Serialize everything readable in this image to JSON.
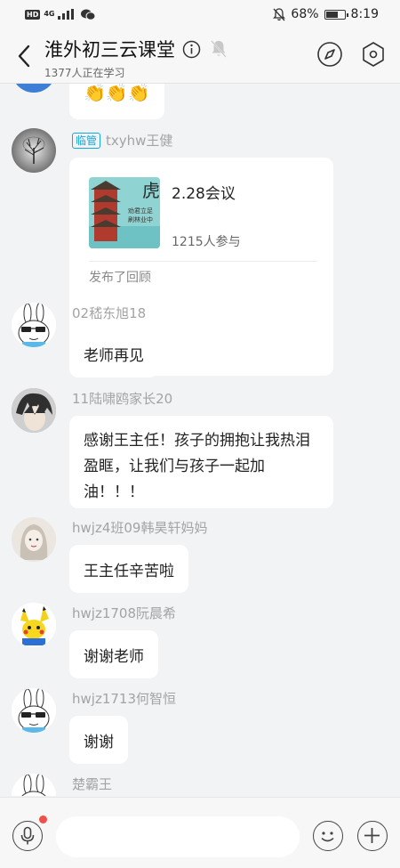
{
  "status_bar": {
    "left_badge": "HD",
    "network": "4G",
    "battery_pct": "68%",
    "battery_level": 0.68,
    "time": "8:19"
  },
  "header": {
    "title": "淮外初三云课堂",
    "subtitle": "1377人正在学习"
  },
  "messages": [
    {
      "type": "text",
      "sender": "",
      "text": "👏👏👏"
    },
    {
      "type": "card",
      "sender": "txyhw王健",
      "role_tag": "临管",
      "card_title": "2.28会议",
      "card_sub": "1215人参与",
      "card_footer": "发布了回顾",
      "thumb_text1": "劝君立足",
      "thumb_text2": "刷林业中"
    },
    {
      "type": "text",
      "sender": "02嵇东旭18",
      "text": "老师再见"
    },
    {
      "type": "text",
      "sender": "11陆啸鸥家长20",
      "text": "感谢王主任！孩子的拥抱让我热泪盈眶，让我们与孩子一起加油！！！"
    },
    {
      "type": "text",
      "sender": "hwjz4班09韩昊轩妈妈",
      "text": "王主任辛苦啦"
    },
    {
      "type": "text",
      "sender": "hwjz1708阮晨希",
      "text": "谢谢老师"
    },
    {
      "type": "text",
      "sender": "hwjz1713何智恒",
      "text": "谢谢"
    },
    {
      "type": "text",
      "sender": "楚霸王",
      "text": ""
    }
  ],
  "input": {
    "placeholder": "",
    "value": ""
  },
  "colors": {
    "accent": "#1aa7d8",
    "bg": "#f2f3f5",
    "badge_red": "#f0504a"
  }
}
